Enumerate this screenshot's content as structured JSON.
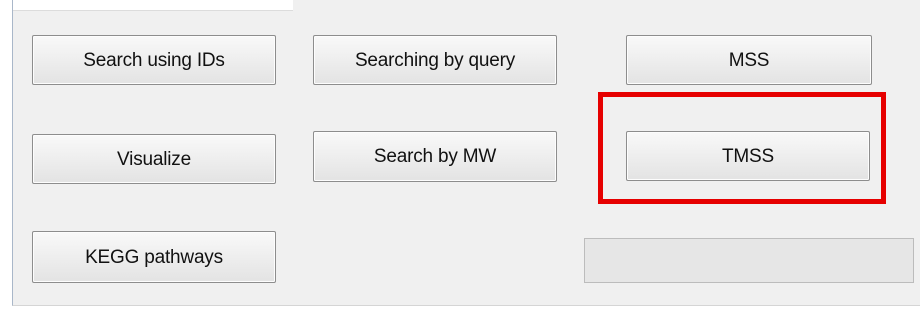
{
  "buttons": {
    "search_ids": "Search using IDs",
    "search_query": "Searching by query",
    "mss": "MSS",
    "visualize": "Visualize",
    "search_mw": "Search by MW",
    "tmss": "TMSS",
    "kegg": "KEGG pathways"
  },
  "progress": {
    "value": 0
  },
  "highlight": {
    "color": "#e60000",
    "target": "TMSS"
  }
}
